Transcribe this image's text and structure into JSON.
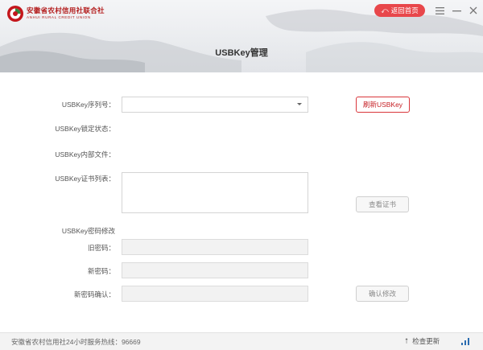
{
  "header": {
    "logo_cn": "安徽省农村信用社联合社",
    "logo_en": "ANHUI RURAL CREDIT UNION",
    "back_label": "返回首页",
    "title": "USBKey管理"
  },
  "form": {
    "serial_label": "USBKey序列号：",
    "serial_value": "",
    "refresh_label": "刷新USBKey",
    "lock_status_label": "USBKey锁定状态：",
    "lock_status_value": "",
    "internal_file_label": "USBKey内部文件：",
    "internal_file_value": "",
    "cert_list_label": "USBKey证书列表：",
    "view_cert_label": "查看证书",
    "pwd_section_label": "USBKey密码修改",
    "old_pwd_label": "旧密码：",
    "new_pwd_label": "新密码：",
    "confirm_pwd_label": "新密码确认：",
    "confirm_change_label": "确认修改"
  },
  "footer": {
    "hotline": "安徽省农村信用社24小时服务热线：96669",
    "update_label": "检查更新"
  },
  "colors": {
    "accent_red": "#e8474b",
    "brand_red": "#b31b1b"
  },
  "icons": [
    "logo-icon",
    "back-arrow-icon",
    "menu-icon",
    "minimize-icon",
    "close-icon",
    "dropdown-caret-icon",
    "update-arrow-icon",
    "signal-icon"
  ]
}
